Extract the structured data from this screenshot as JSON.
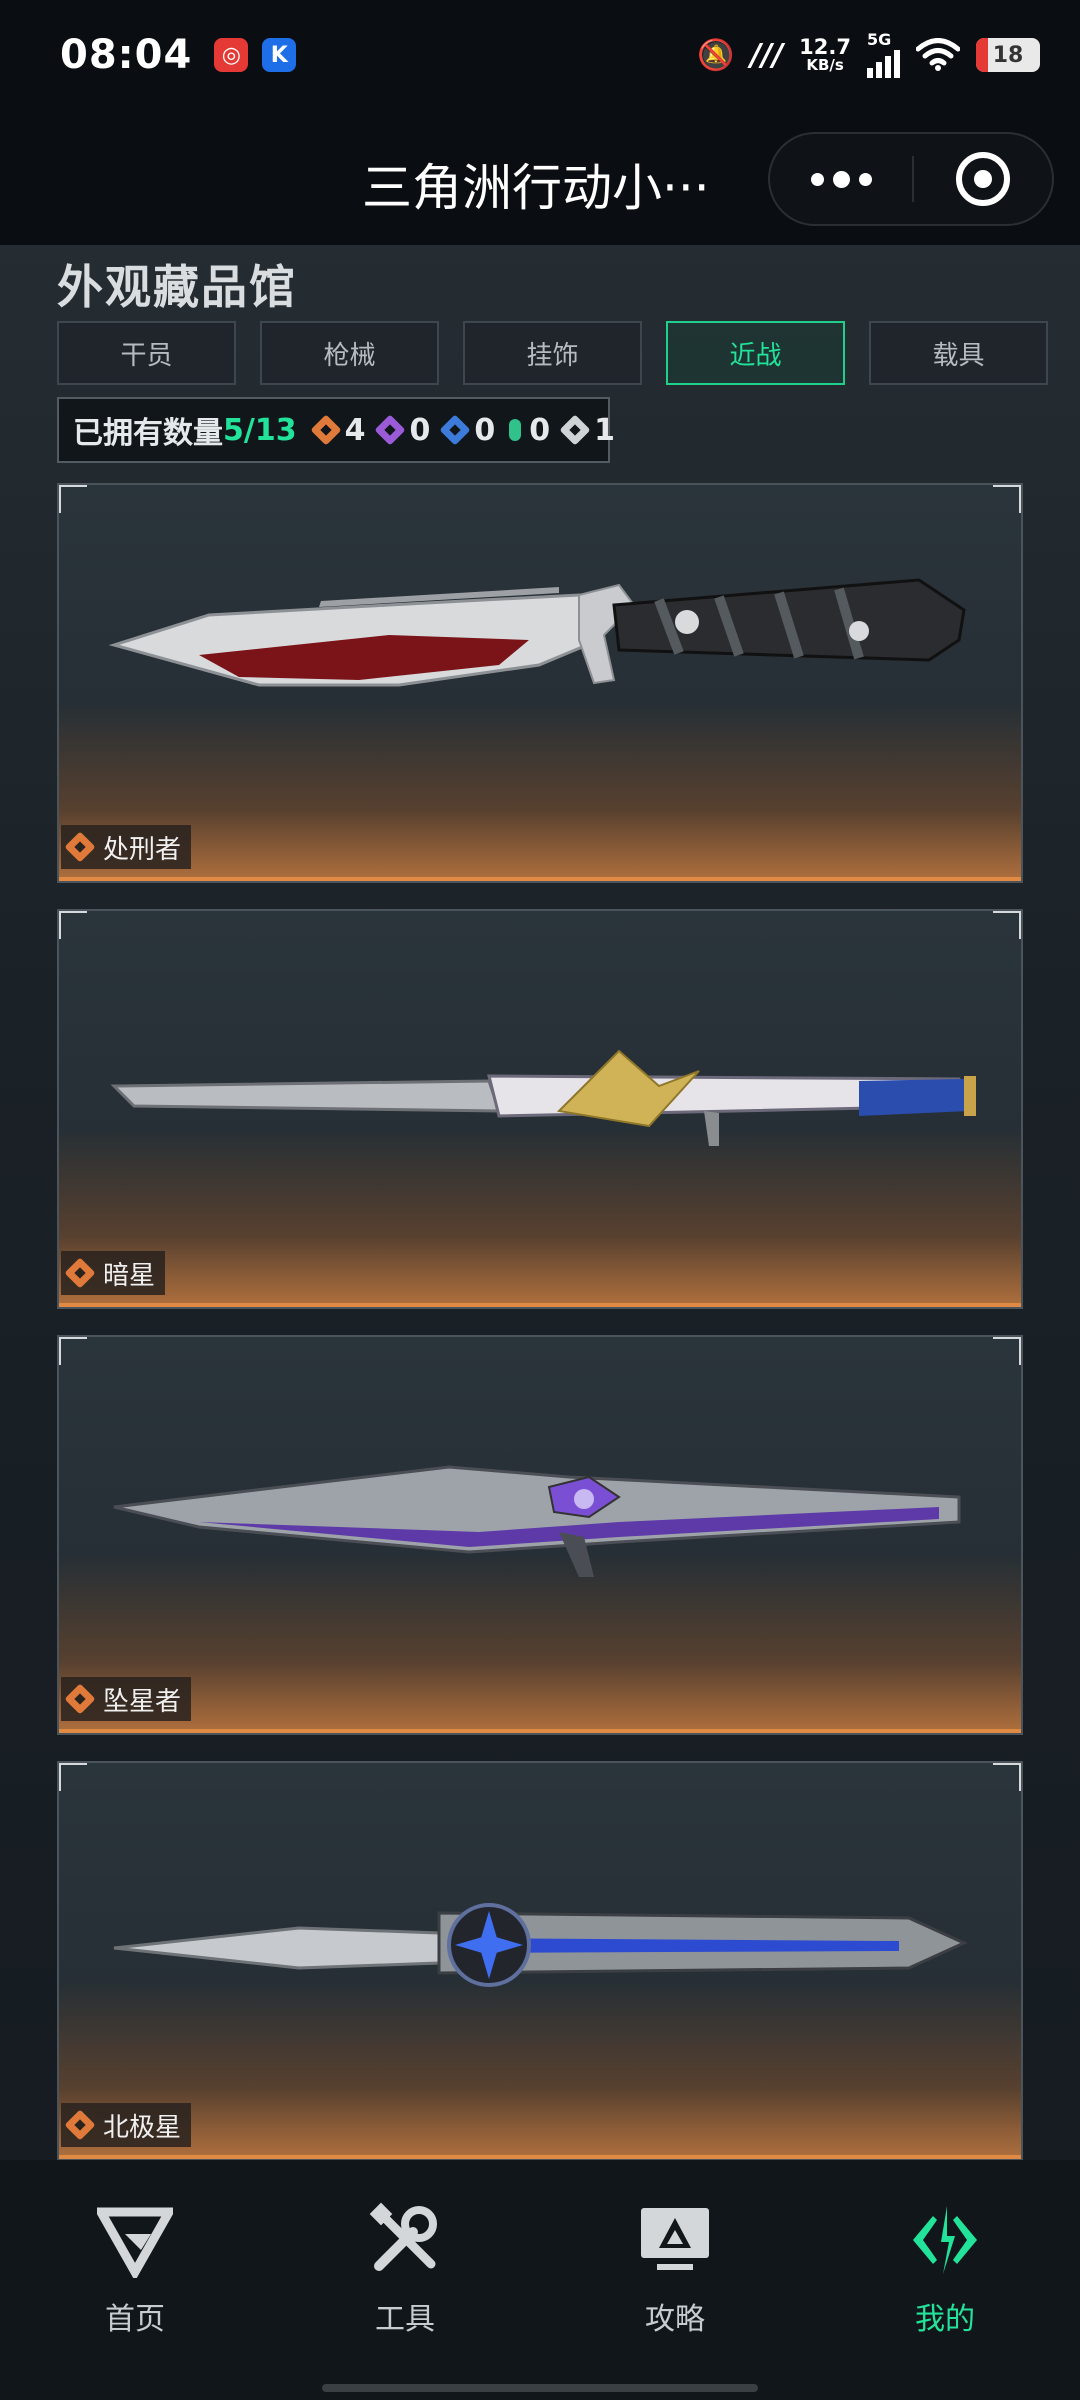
{
  "status_bar": {
    "time": "08:04",
    "app_icons": [
      "app-red-icon",
      "app-blue-k-icon"
    ],
    "speed_value": "12.7",
    "speed_unit": "KB/s",
    "network": "5G",
    "battery": "18"
  },
  "header": {
    "title": "三角洲行动小···"
  },
  "page": {
    "title": "外观藏品馆",
    "tabs": [
      {
        "label": "干员",
        "active": false
      },
      {
        "label": "枪械",
        "active": false
      },
      {
        "label": "挂饰",
        "active": false
      },
      {
        "label": "近战",
        "active": true
      },
      {
        "label": "载具",
        "active": false
      }
    ],
    "owned": {
      "label": "已拥有数量",
      "count": "5/13",
      "rarities": [
        {
          "icon": "orange-gem-icon",
          "color": "#e07a3a",
          "value": "4"
        },
        {
          "icon": "purple-gem-icon",
          "color": "#9b5bd8",
          "value": "0"
        },
        {
          "icon": "blue-gem-icon",
          "color": "#3c7bd9",
          "value": "0"
        },
        {
          "icon": "green-gem-icon",
          "color": "#30c28a",
          "value": "0"
        },
        {
          "icon": "white-gem-icon",
          "color": "#cfd3d6",
          "value": "1"
        }
      ]
    },
    "items": [
      {
        "name": "处刑者",
        "rarity": "orange"
      },
      {
        "name": "暗星",
        "rarity": "orange"
      },
      {
        "name": "坠星者",
        "rarity": "orange"
      },
      {
        "name": "北极星",
        "rarity": "orange"
      }
    ]
  },
  "bottom_nav": [
    {
      "label": "首页",
      "icon": "home-logo-icon",
      "active": false
    },
    {
      "label": "工具",
      "icon": "tools-icon",
      "active": false
    },
    {
      "label": "攻略",
      "icon": "guide-monitor-icon",
      "active": false
    },
    {
      "label": "我的",
      "icon": "profile-logo-icon",
      "active": true
    }
  ],
  "colors": {
    "accent": "#22e39a",
    "rarity_orange": "#e07a3a"
  }
}
